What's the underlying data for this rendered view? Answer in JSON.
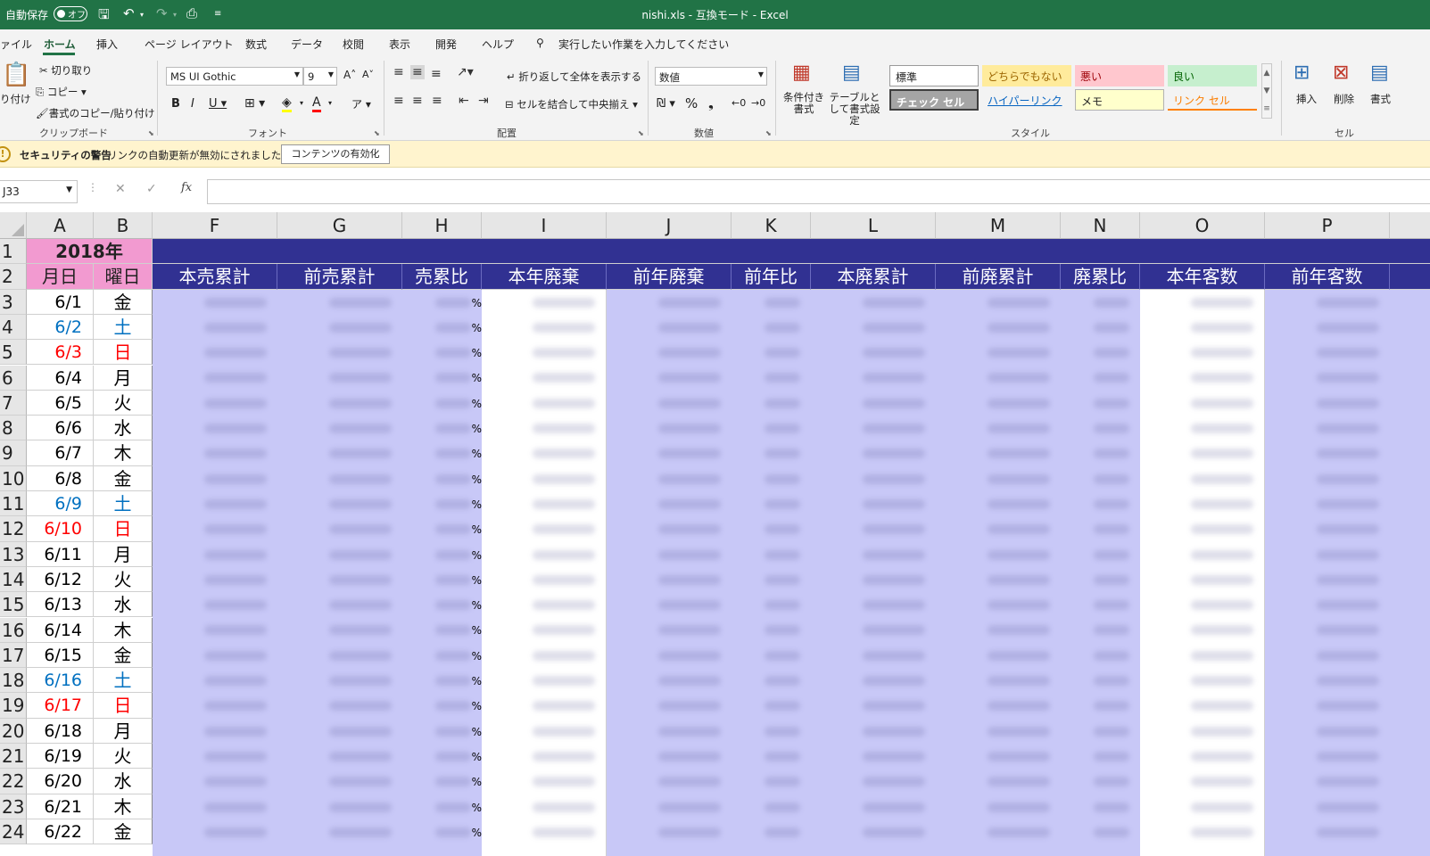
{
  "titlebar": {
    "autosave_label": "自動保存",
    "autosave_state": "オフ",
    "title": "nishi.xls  -  互換モード  -  Excel"
  },
  "tabs": [
    "ァイル",
    "ホーム",
    "挿入",
    "ページ レイアウト",
    "数式",
    "データ",
    "校閲",
    "表示",
    "開発",
    "ヘルプ"
  ],
  "tell_me": "実行したい作業を入力してください",
  "clipboard": {
    "paste": "り付け",
    "cut": "切り取り",
    "copy": "コピー",
    "format_painter": "書式のコピー/貼り付け",
    "group": "クリップボード"
  },
  "font": {
    "name": "MS UI Gothic",
    "size": "9",
    "group": "フォント"
  },
  "alignment": {
    "wrap": "折り返して全体を表示する",
    "merge": "セルを結合して中央揃え",
    "group": "配置"
  },
  "number": {
    "format": "数値",
    "group": "数値"
  },
  "styles": {
    "conditional": "条件付き書式",
    "as_table": "テーブルとして書式設定",
    "normal": "標準",
    "neutral": "どちらでもない",
    "bad": "悪い",
    "good": "良い",
    "check_cell": "チェック セル",
    "hyperlink": "ハイパーリンク",
    "note": "メモ",
    "linked_cell": "リンク セル",
    "group": "スタイル"
  },
  "cells": {
    "insert": "挿入",
    "delete": "削除",
    "format": "書式",
    "group": "セル"
  },
  "security": {
    "title": "セキュリティの警告",
    "message": "リンクの自動更新が無効にされました",
    "button": "コンテンツの有効化"
  },
  "formula_bar": {
    "name_box": "J33",
    "fx": "fx"
  },
  "sheet": {
    "column_letters": [
      "A",
      "B",
      "F",
      "G",
      "H",
      "I",
      "J",
      "K",
      "L",
      "M",
      "N",
      "O",
      "P"
    ],
    "year_header": "2018年",
    "date_header": "月日",
    "dow_header": "曜日",
    "metric_headers": [
      "本売累計",
      "前売累計",
      "売累比",
      "本年廃棄",
      "前年廃棄",
      "前年比",
      "本廃累計",
      "前廃累計",
      "廃累比",
      "本年客数",
      "前年客数"
    ],
    "pct_symbol": "%",
    "rows": [
      {
        "num": "1"
      },
      {
        "num": "2"
      },
      {
        "num": "3",
        "date": "6/1",
        "dow": "金",
        "type": "weekday"
      },
      {
        "num": "4",
        "date": "6/2",
        "dow": "土",
        "type": "sat"
      },
      {
        "num": "5",
        "date": "6/3",
        "dow": "日",
        "type": "sun"
      },
      {
        "num": "6",
        "date": "6/4",
        "dow": "月",
        "type": "weekday"
      },
      {
        "num": "7",
        "date": "6/5",
        "dow": "火",
        "type": "weekday"
      },
      {
        "num": "8",
        "date": "6/6",
        "dow": "水",
        "type": "weekday"
      },
      {
        "num": "9",
        "date": "6/7",
        "dow": "木",
        "type": "weekday"
      },
      {
        "num": "10",
        "date": "6/8",
        "dow": "金",
        "type": "weekday"
      },
      {
        "num": "11",
        "date": "6/9",
        "dow": "土",
        "type": "sat"
      },
      {
        "num": "12",
        "date": "6/10",
        "dow": "日",
        "type": "sun"
      },
      {
        "num": "13",
        "date": "6/11",
        "dow": "月",
        "type": "weekday"
      },
      {
        "num": "14",
        "date": "6/12",
        "dow": "火",
        "type": "weekday"
      },
      {
        "num": "15",
        "date": "6/13",
        "dow": "水",
        "type": "weekday"
      },
      {
        "num": "16",
        "date": "6/14",
        "dow": "木",
        "type": "weekday"
      },
      {
        "num": "17",
        "date": "6/15",
        "dow": "金",
        "type": "weekday"
      },
      {
        "num": "18",
        "date": "6/16",
        "dow": "土",
        "type": "sat"
      },
      {
        "num": "19",
        "date": "6/17",
        "dow": "日",
        "type": "sun"
      },
      {
        "num": "20",
        "date": "6/18",
        "dow": "月",
        "type": "weekday"
      },
      {
        "num": "21",
        "date": "6/19",
        "dow": "火",
        "type": "weekday"
      },
      {
        "num": "22",
        "date": "6/20",
        "dow": "水",
        "type": "weekday"
      },
      {
        "num": "23",
        "date": "6/21",
        "dow": "木",
        "type": "weekday"
      },
      {
        "num": "24",
        "date": "6/22",
        "dow": "金",
        "type": "weekday"
      }
    ]
  },
  "colors": {
    "excel_green": "#217346",
    "header_navy": "#313192",
    "header_pink": "#f29ad0",
    "data_lavender": "#c8c8f7",
    "saturday_blue": "#0070c0",
    "sunday_red": "#ff0000"
  }
}
